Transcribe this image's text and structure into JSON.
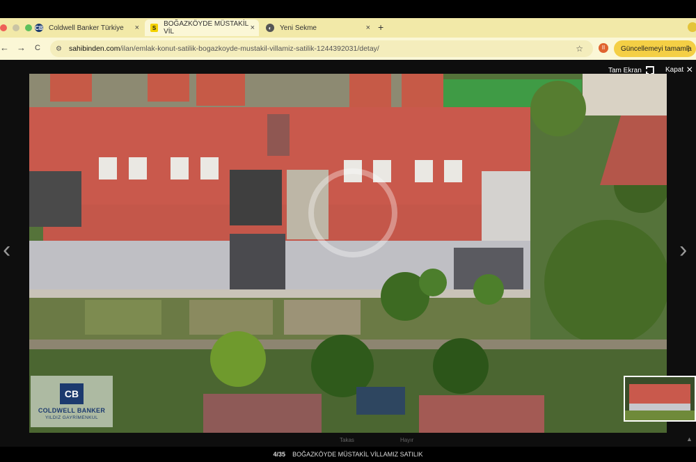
{
  "browser": {
    "tabs": [
      {
        "label": "Coldwell Banker Türkiye",
        "favicon": "CB",
        "close": "×"
      },
      {
        "label": "BOĞAZKÖYDE MÜSTAKİL VİL",
        "favicon": "S",
        "close": "×"
      },
      {
        "label": "Yeni Sekme",
        "favicon": "◐",
        "close": "×"
      }
    ],
    "new_tab": "+",
    "nav": {
      "back": "←",
      "forward": "→",
      "reload": "C"
    },
    "url_host": "sahibinden.com",
    "url_path": "/ilan/emlak-konut-satilik-bogazkoyde-mustakil-villamiz-satilik-1244392031/detay/",
    "star": "☆",
    "update_button": "Güncellemeyi tamamla",
    "update_dots": "⋮"
  },
  "viewer": {
    "fullscreen_label": "Tam Ekran",
    "close_label": "Kapat",
    "close_icon": "×",
    "prev_icon": "‹",
    "next_icon": "›",
    "counter": "4/35",
    "caption": "BOĞAZKÖYDE MÜSTAKİL VİLLAMIZ SATILIK",
    "under_left": "Takas",
    "under_right": "Hayır",
    "scroll_arrow": "▲"
  },
  "watermark": {
    "brand": "COLDWELL BANKER",
    "office": "YILDIZ GAYRİMENKUL",
    "monogram": "CB"
  },
  "colors": {
    "tabbar": "#f2e9a8",
    "toolbar": "#fbf7d6",
    "update_button": "#f4cf45",
    "roof": "#c9594c",
    "brand_blue": "#1c3a6e"
  }
}
